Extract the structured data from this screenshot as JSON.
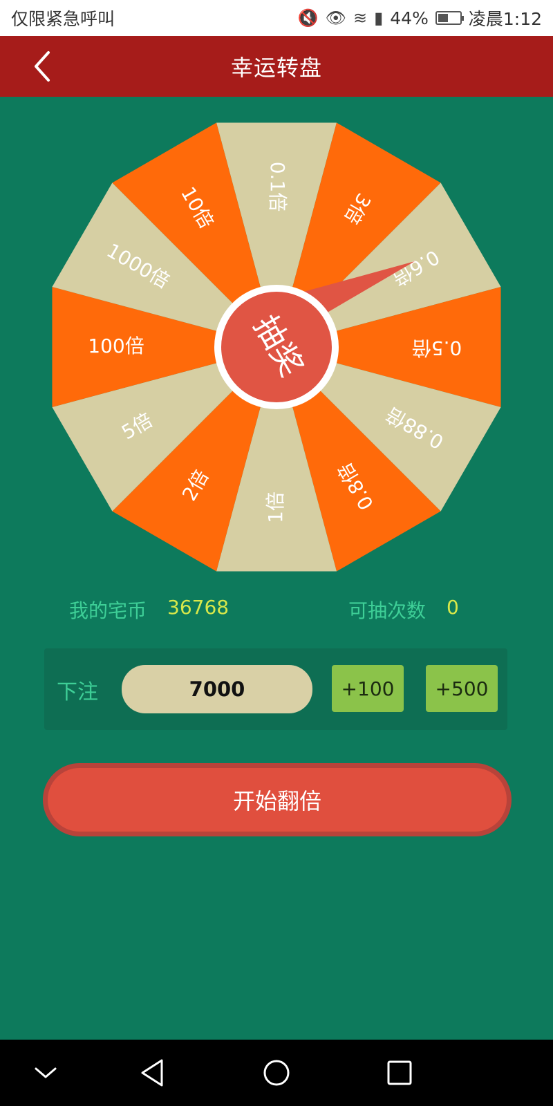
{
  "status_bar": {
    "left_text": "仅限紧急呼叫",
    "battery": "44%",
    "time": "凌晨1:12"
  },
  "header": {
    "title": "幸运转盘"
  },
  "wheel": {
    "center_label": "抽奖",
    "colors": {
      "orange": "#ff6a0a",
      "beige": "#d6cfa3",
      "center": "#e05544",
      "ring": "#ffffff"
    },
    "segments": [
      "0.1倍",
      "3倍",
      "0.6倍",
      "0.5倍",
      "0.88倍",
      "0.8倍",
      "1倍",
      "2倍",
      "5倍",
      "100倍",
      "1000倍",
      "10倍"
    ]
  },
  "info": {
    "coins_label": "我的宅币",
    "coins_value": "36768",
    "draws_label": "可抽次数",
    "draws_value": "0"
  },
  "bet": {
    "label": "下注",
    "value": "7000",
    "plus_100": "+100",
    "plus_500": "+500"
  },
  "start_button": "开始翻倍"
}
